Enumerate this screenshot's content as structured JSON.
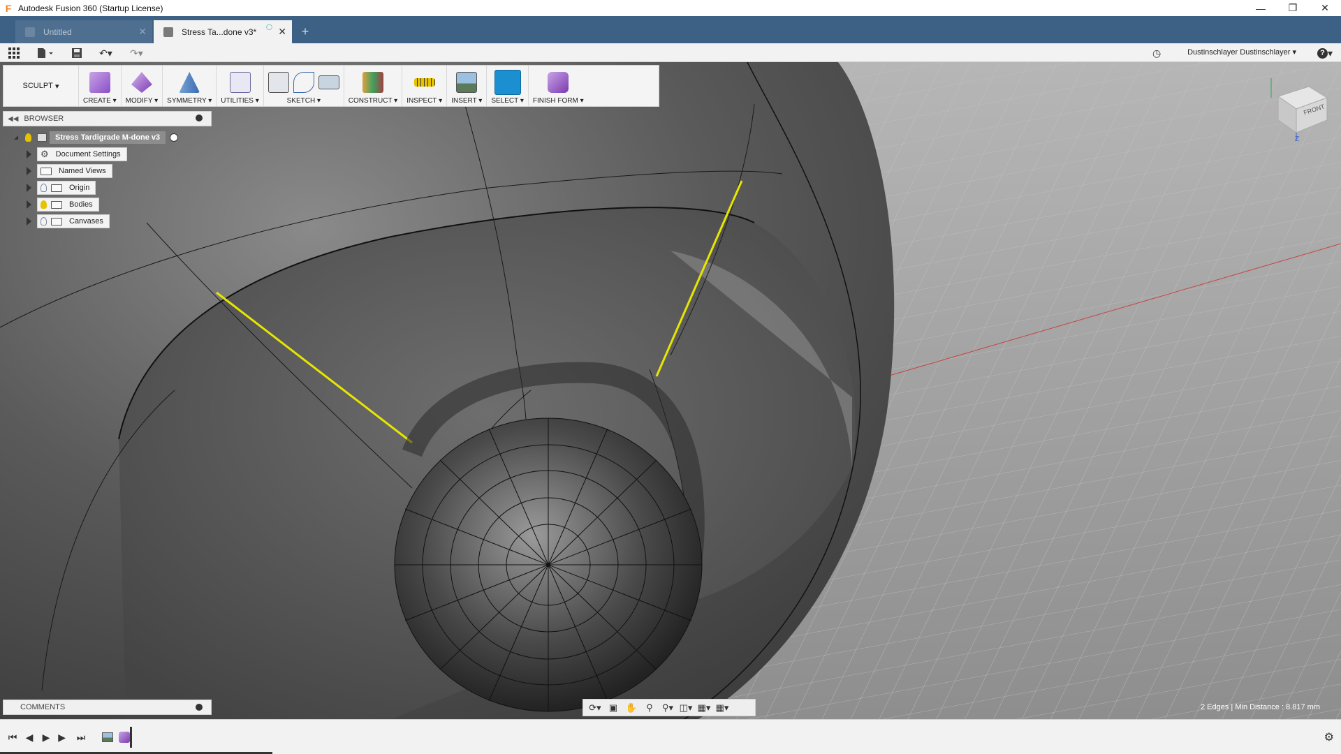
{
  "window": {
    "title": "Autodesk Fusion 360 (Startup License)",
    "app_logo": "F"
  },
  "tabs": [
    {
      "label": "Untitled",
      "active": false
    },
    {
      "label": "Stress Ta...done v3*",
      "active": true
    }
  ],
  "quick_access": {
    "user": "Dustinschlayer Dustinschlayer",
    "help": "?"
  },
  "toolbar": {
    "workspace": "SCULPT",
    "groups": [
      {
        "label": "CREATE"
      },
      {
        "label": "MODIFY"
      },
      {
        "label": "SYMMETRY"
      },
      {
        "label": "UTILITIES"
      },
      {
        "label": "SKETCH"
      },
      {
        "label": "CONSTRUCT"
      },
      {
        "label": "INSPECT"
      },
      {
        "label": "INSERT"
      },
      {
        "label": "SELECT"
      },
      {
        "label": "FINISH FORM"
      }
    ]
  },
  "browser": {
    "title": "BROWSER",
    "root": "Stress Tardigrade M-done v3",
    "nodes": [
      {
        "label": "Document Settings"
      },
      {
        "label": "Named Views"
      },
      {
        "label": "Origin"
      },
      {
        "label": "Bodies"
      },
      {
        "label": "Canvases"
      }
    ]
  },
  "comments": {
    "title": "COMMENTS"
  },
  "status": {
    "text": "2 Edges | Min Distance : 8.817 mm"
  },
  "viewcube": {
    "face": "FRONT",
    "axis_z": "Z"
  },
  "colors": {
    "tab_bar": "#3d6184",
    "selection": "#e6e600",
    "select_active": "#1b8fd0"
  }
}
